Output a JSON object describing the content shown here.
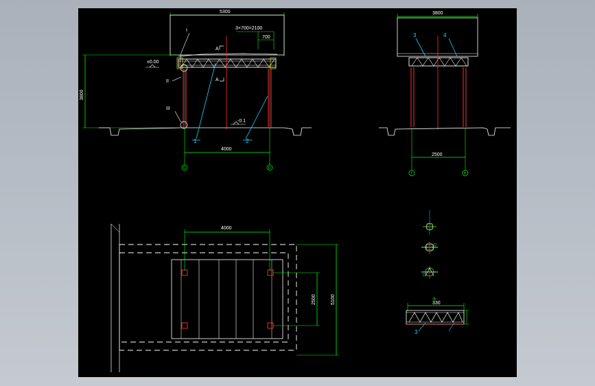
{
  "colors": {
    "background": "#000000",
    "frame_bg": "#b7bdc6",
    "dimension": "#00ff00",
    "outline": "#ffffff",
    "member": "#ff3030",
    "leader": "#18d8ff",
    "axis": "#00ff00"
  },
  "elevation_front": {
    "dim_total_width": "5300",
    "dim_spacing": "3×700=2100",
    "dim_small": "700",
    "dim_height": "3800",
    "dim_column_span": "4000",
    "section_a": "A",
    "section_a2": "A",
    "detail_i": "I",
    "detail_ii": "II",
    "detail_iii": "III",
    "callout_1": "1",
    "callout_2": "2",
    "level_top": "±0.00",
    "level_ground": "-0.1",
    "axis_c": "C",
    "axis_d": "D"
  },
  "elevation_side": {
    "dim_total_width": "3800",
    "dim_column_span": "2500",
    "callout_3": "3",
    "callout_4": "4",
    "axis_left": "7",
    "axis_right": "8"
  },
  "plan": {
    "dim_columns": "4000",
    "dim_width": "2500",
    "dim_total": "5100"
  },
  "truss_detail": {
    "dim_top": "330",
    "callout": "3"
  }
}
